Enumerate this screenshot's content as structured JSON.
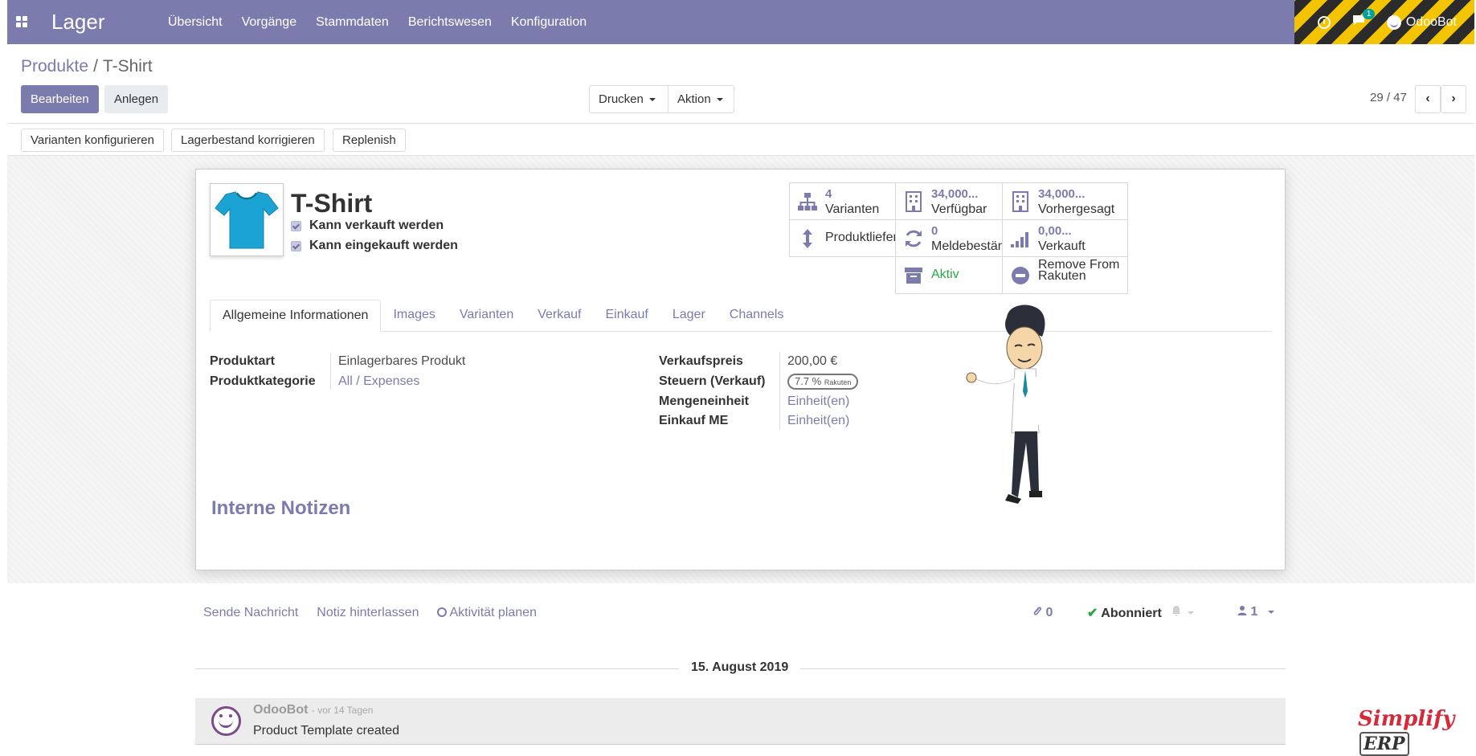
{
  "navbar": {
    "app_name": "Lager",
    "menu": [
      "Übersicht",
      "Vorgänge",
      "Stammdaten",
      "Berichtswesen",
      "Konfiguration"
    ],
    "chat_count": "1",
    "user": "OdooBot"
  },
  "breadcrumb": {
    "parent": "Produkte",
    "sep": "/",
    "current": "T-Shirt"
  },
  "toolbar": {
    "edit": "Bearbeiten",
    "create": "Anlegen",
    "print": "Drucken",
    "action": "Aktion",
    "pager": "29 / 47"
  },
  "header_buttons": {
    "configure_variants": "Varianten konfigurieren",
    "adjust_stock": "Lagerbestand korrigieren",
    "replenish": "Replenish"
  },
  "product": {
    "name": "T-Shirt",
    "sale_ok": "Kann verkauft werden",
    "purchase_ok": "Kann eingekauft werden"
  },
  "smart_buttons": {
    "variants": {
      "value": "4",
      "label": "Varianten",
      "icon": "sitemap-icon"
    },
    "available": {
      "value": "34,000...",
      "label": "Verfügbar",
      "icon": "building-icon"
    },
    "forecast": {
      "value": "34,000...",
      "label": "Vorhergesagt",
      "icon": "building-icon"
    },
    "routes": {
      "label": "Produktlieferung",
      "icon": "arrows-v-icon"
    },
    "reordering": {
      "value": "0",
      "label": "Meldebestände",
      "icon": "refresh-icon"
    },
    "sold": {
      "value": "0,00...",
      "label": "Verkauft",
      "icon": "signal-icon"
    },
    "active": {
      "label": "Aktiv",
      "icon": "archive-icon",
      "color": "#28a745"
    },
    "rakuten": {
      "label_1": "Remove From",
      "label_2": "Rakuten",
      "icon": "minus-circle-icon"
    }
  },
  "tabs": [
    "Allgemeine Informationen",
    "Images",
    "Varianten",
    "Verkauf",
    "Einkauf",
    "Lager",
    "Channels"
  ],
  "fields_left": [
    {
      "label": "Produktart",
      "value": "Einlagerbares Produkt"
    },
    {
      "label": "Produktkategorie",
      "value": "All / Expenses"
    }
  ],
  "fields_right": [
    {
      "label": "Verkaufspreis",
      "value": "200,00 €"
    },
    {
      "label": "Steuern (Verkauf)",
      "value": ""
    },
    {
      "label": "Mengeneinheit",
      "value": "Einheit(en)"
    },
    {
      "label": "Einkauf ME",
      "value": "Einheit(en)"
    }
  ],
  "tax_tag": {
    "main": "7.7 %",
    "small": "Rakuten"
  },
  "notes_heading": "Interne Notizen",
  "chatter": {
    "send": "Sende Nachricht",
    "note": "Notiz hinterlassen",
    "activity": "Aktivität planen",
    "attachments": "0",
    "followed": "Abonniert",
    "followers": "1",
    "date": "15. August 2019",
    "message": {
      "author": "OdooBot",
      "time": "- vor 14 Tagen",
      "text": "Product Template created"
    }
  },
  "watermark": {
    "main": "Simplify",
    "boxed": "ERP"
  },
  "colors": {
    "brand": "#7c7bad",
    "accent": "#00a09d"
  }
}
